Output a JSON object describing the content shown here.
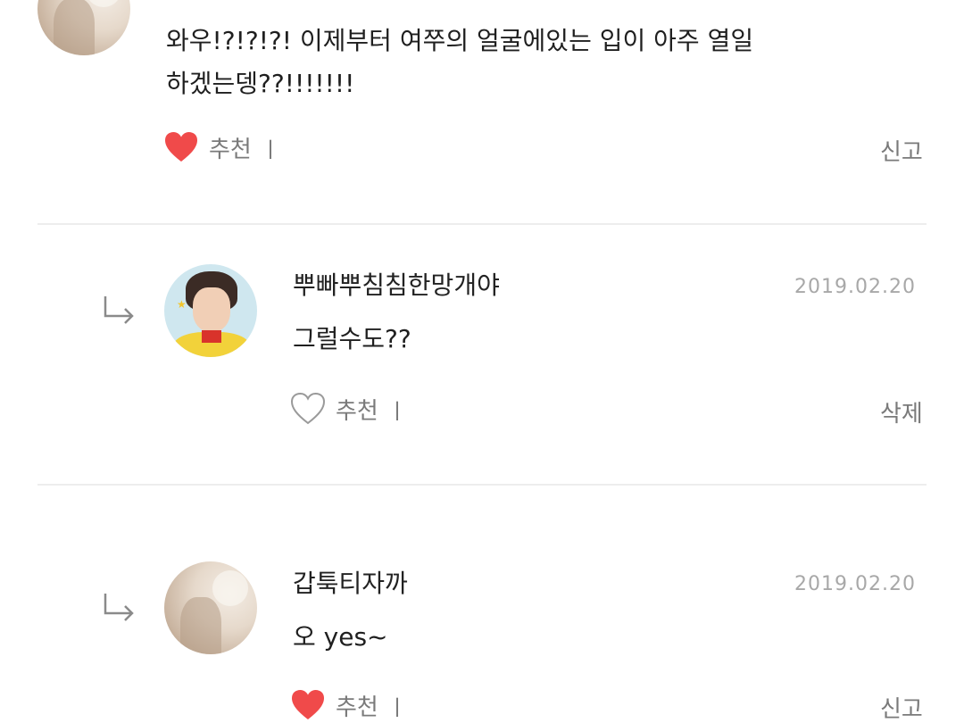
{
  "comments": [
    {
      "nickname": "",
      "text_lines": [
        "와우!?!?!?! 이제부터 여쭈의 얼굴에있는 입이 아주 열일",
        "하겠는뎅??!!!!!!!"
      ],
      "like_label": "추천",
      "like_count": "ㅣ",
      "liked": true,
      "action": "신고"
    },
    {
      "nickname": "뿌빠뿌침침한망개야",
      "date": "2019.02.20",
      "text": "그럴수도??",
      "like_label": "추천",
      "like_count": "ㅣ",
      "liked": false,
      "action": "삭제"
    },
    {
      "nickname": "갑툭티자까",
      "date": "2019.02.20",
      "text": "오 yes~",
      "like_label": "추천",
      "like_count": "ㅣ",
      "liked": true,
      "action": "신고"
    }
  ],
  "colors": {
    "heart_filled": "#f04a4a",
    "heart_outline": "#9a9a9a",
    "divider": "#ededed",
    "muted_text": "#7a7a7a",
    "date_text": "#a8a8a8"
  },
  "icons": {
    "reply": "reply-arrow-icon",
    "heart_filled": "heart-filled-icon",
    "heart_outline": "heart-outline-icon"
  }
}
